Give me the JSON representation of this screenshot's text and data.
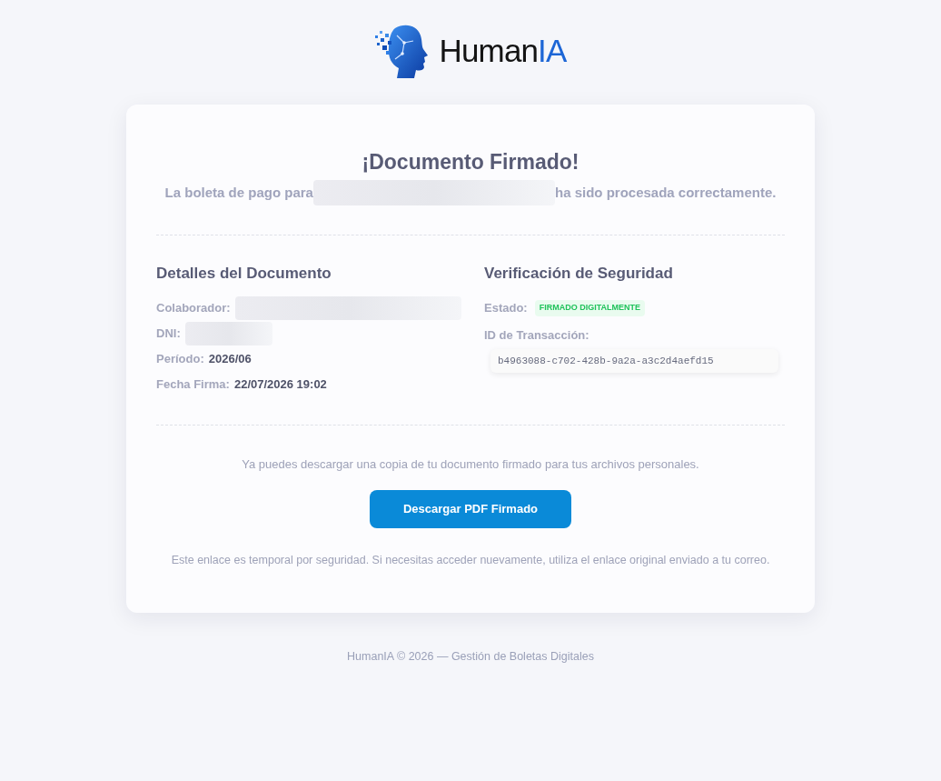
{
  "logo": {
    "text_main": "Human",
    "text_accent": "IA"
  },
  "card": {
    "title": "¡Documento Firmado!",
    "subtitle_before": "La boleta de pago para",
    "subtitle_after": "ha sido procesada correctamente.",
    "details": {
      "heading": "Detalles del Documento",
      "fields": [
        {
          "label": "Colaborador:",
          "kind": "redacted"
        },
        {
          "label": "DNI:",
          "kind": "redacted"
        },
        {
          "label": "Período:",
          "kind": "text",
          "value": "2026/06"
        },
        {
          "label": "Fecha Firma:",
          "kind": "text",
          "value": "22/07/2026 19:02"
        }
      ]
    },
    "security": {
      "heading": "Verificación de Seguridad",
      "status_label": "Estado:",
      "status_badge": "FIRMADO DIGITALMENTE",
      "transaction_label": "ID de Transacción:",
      "transaction_id": "b4963088-c702-428b-9a2a-a3c2d4aefd15"
    },
    "download_note": "Ya puedes descargar una copia de tu documento firmado para tus archivos personales.",
    "download_button": "Descargar PDF Firmado",
    "temporary_note": "Este enlace es temporal por seguridad. Si necesitas acceder nuevamente, utiliza el enlace original enviado a tu correo."
  },
  "footer": "HumanIA © 2026 — Gestión de Boletas Digitales"
}
